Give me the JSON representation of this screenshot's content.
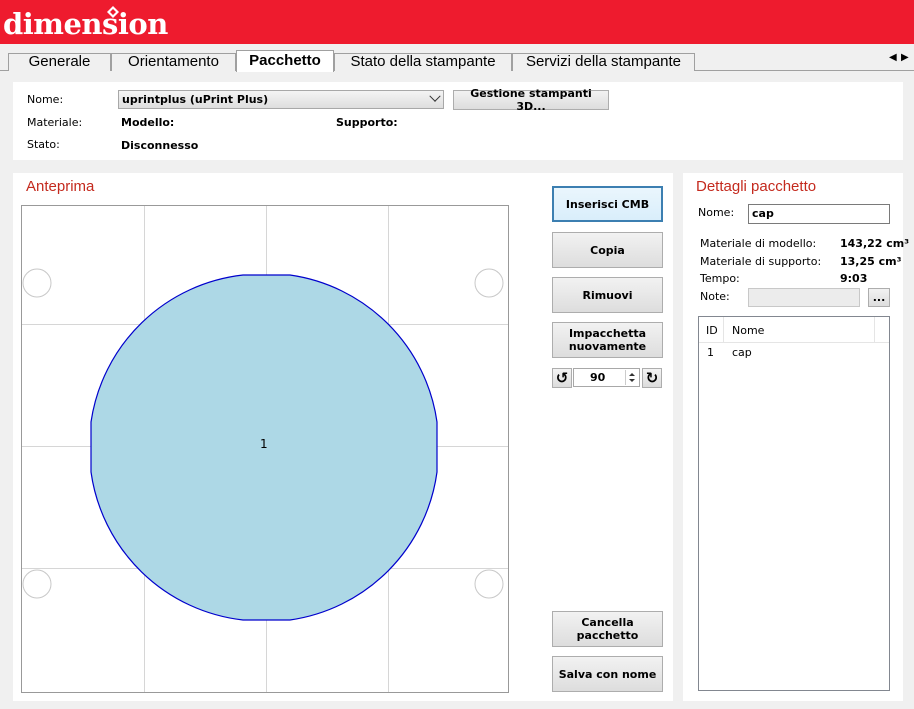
{
  "app": {
    "logo_text": "dimension"
  },
  "tabs": [
    {
      "label": "Generale"
    },
    {
      "label": "Orientamento"
    },
    {
      "label": "Pacchetto",
      "active": true
    },
    {
      "label": "Stato della stampante"
    },
    {
      "label": "Servizi della stampante"
    }
  ],
  "printer": {
    "name_label": "Nome:",
    "name_value": "uprintplus  (uPrint Plus)",
    "manage_button": "Gestione stampanti 3D...",
    "material_label": "Materiale:",
    "model_label": "Modello:",
    "support_label": "Supporto:",
    "status_label": "Stato:",
    "status_value": "Disconnesso"
  },
  "preview": {
    "title": "Anteprima",
    "part_label": "1",
    "part_color": "#add8e6",
    "outline_color": "#0000cc"
  },
  "actions": {
    "insert": "Inserisci CMB",
    "copy": "Copia",
    "remove": "Rimuovi",
    "repack": "Impacchetta nuovamente",
    "rotation_value": "90",
    "clear": "Cancella pacchetto",
    "save_as": "Salva con nome"
  },
  "details": {
    "title": "Dettagli pacchetto",
    "name_label": "Nome:",
    "name_value": "cap",
    "model_material_label": "Materiale di modello:",
    "model_material_value": "143,22 cm³",
    "support_material_label": "Materiale di supporto:",
    "support_material_value": "13,25 cm³",
    "time_label": "Tempo:",
    "time_value": "9:03",
    "notes_label": "Note:",
    "notes_button": "...",
    "columns": [
      "ID",
      "Nome"
    ],
    "rows": [
      {
        "id": "1",
        "name": "cap"
      }
    ]
  },
  "colors": {
    "brand": "#ee1b2e",
    "section_title": "#c42a1e",
    "focus_border": "#3c7fb1"
  }
}
